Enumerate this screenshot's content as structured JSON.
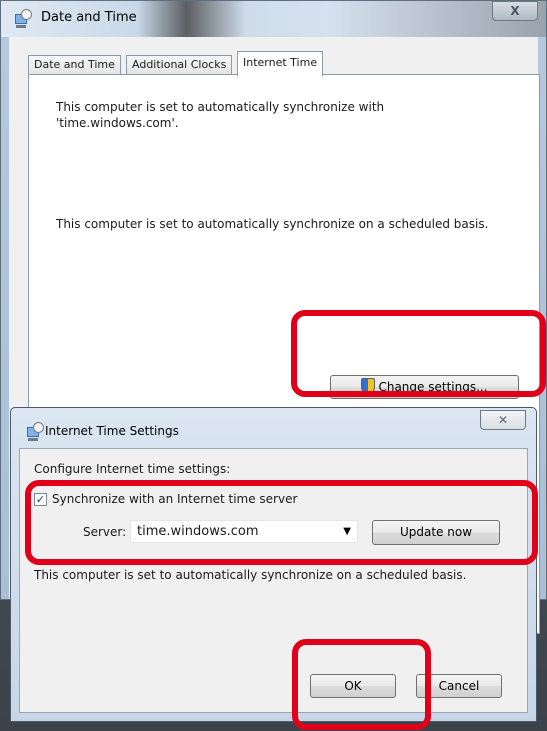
{
  "main_window": {
    "title": "Date and Time",
    "close_label": "X",
    "tabs": [
      "Date and Time",
      "Additional Clocks",
      "Internet Time"
    ],
    "active_tab": "Internet Time",
    "sync_server_text": "This computer is set to automatically synchronize with 'time.windows.com'.",
    "schedule_text": "This computer is set to automatically synchronize on a scheduled basis.",
    "change_settings_label": "Change settings..."
  },
  "dialog": {
    "title": "Internet Time Settings",
    "close_label": "✕",
    "configure_label": "Configure Internet time settings:",
    "sync_checkbox_label": "Synchronize with an Internet time server",
    "sync_checked": true,
    "server_label": "Server:",
    "server_value": "time.windows.com",
    "update_button_label": "Update now",
    "status_text": "This computer is set to automatically synchronize on a scheduled basis.",
    "ok_label": "OK",
    "cancel_label": "Cancel"
  },
  "highlight_color": "#e0001a"
}
